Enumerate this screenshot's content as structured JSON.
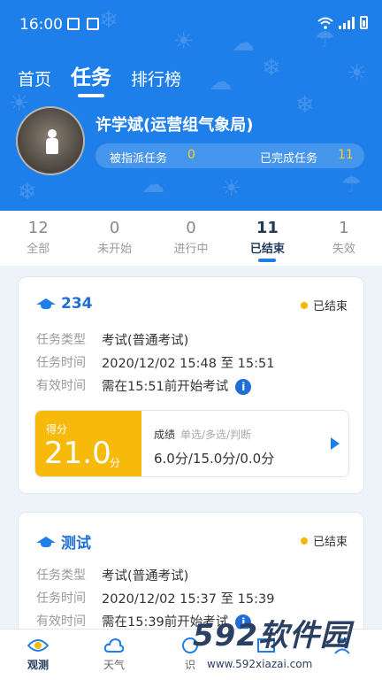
{
  "status_bar": {
    "time": "16:00"
  },
  "top_nav": {
    "tabs": [
      "首页",
      "任务",
      "排行榜"
    ],
    "active": 1
  },
  "user": {
    "name": "许学斌(运营组气象局)",
    "assigned_label": "被指派任务",
    "assigned_count": "0",
    "completed_label": "已完成任务",
    "completed_count": "11"
  },
  "filter_tabs": [
    {
      "count": "12",
      "label": "全部"
    },
    {
      "count": "0",
      "label": "未开始"
    },
    {
      "count": "0",
      "label": "进行中"
    },
    {
      "count": "11",
      "label": "已结束"
    },
    {
      "count": "1",
      "label": "失效"
    }
  ],
  "filter_active": 3,
  "tasks": [
    {
      "title": "234",
      "status": "已结束",
      "type_label": "任务类型",
      "type_value": "考试(普通考试)",
      "time_label": "任务时间",
      "time_value": "2020/12/02 15:48 至 15:51",
      "valid_label": "有效时间",
      "valid_value": "需在15:51前开始考试",
      "score": {
        "label": "得分",
        "value": "21.0",
        "unit": "分",
        "breakdown_title": "成绩",
        "breakdown_sub": "单选/多选/判断",
        "breakdown_value": "6.0分/15.0分/0.0分"
      }
    },
    {
      "title": "测试",
      "status": "已结束",
      "type_label": "任务类型",
      "type_value": "考试(普通考试)",
      "time_label": "任务时间",
      "time_value": "2020/12/02 15:37 至 15:39",
      "valid_label": "有效时间",
      "valid_value": "需在15:39前开始考试"
    }
  ],
  "bottom_nav": [
    {
      "label": "观测",
      "icon": "eye-icon"
    },
    {
      "label": "天气",
      "icon": "cloud-icon"
    },
    {
      "label": "识",
      "icon": "recognize-icon"
    },
    {
      "label": "",
      "icon": "book-icon"
    },
    {
      "label": "",
      "icon": "person-icon"
    }
  ],
  "watermark": {
    "text": "592软件园",
    "url": "www.592xiazai.com"
  },
  "colors": {
    "primary": "#1f7fea",
    "accent": "#f7b90a",
    "highlight": "#ffcf26"
  }
}
